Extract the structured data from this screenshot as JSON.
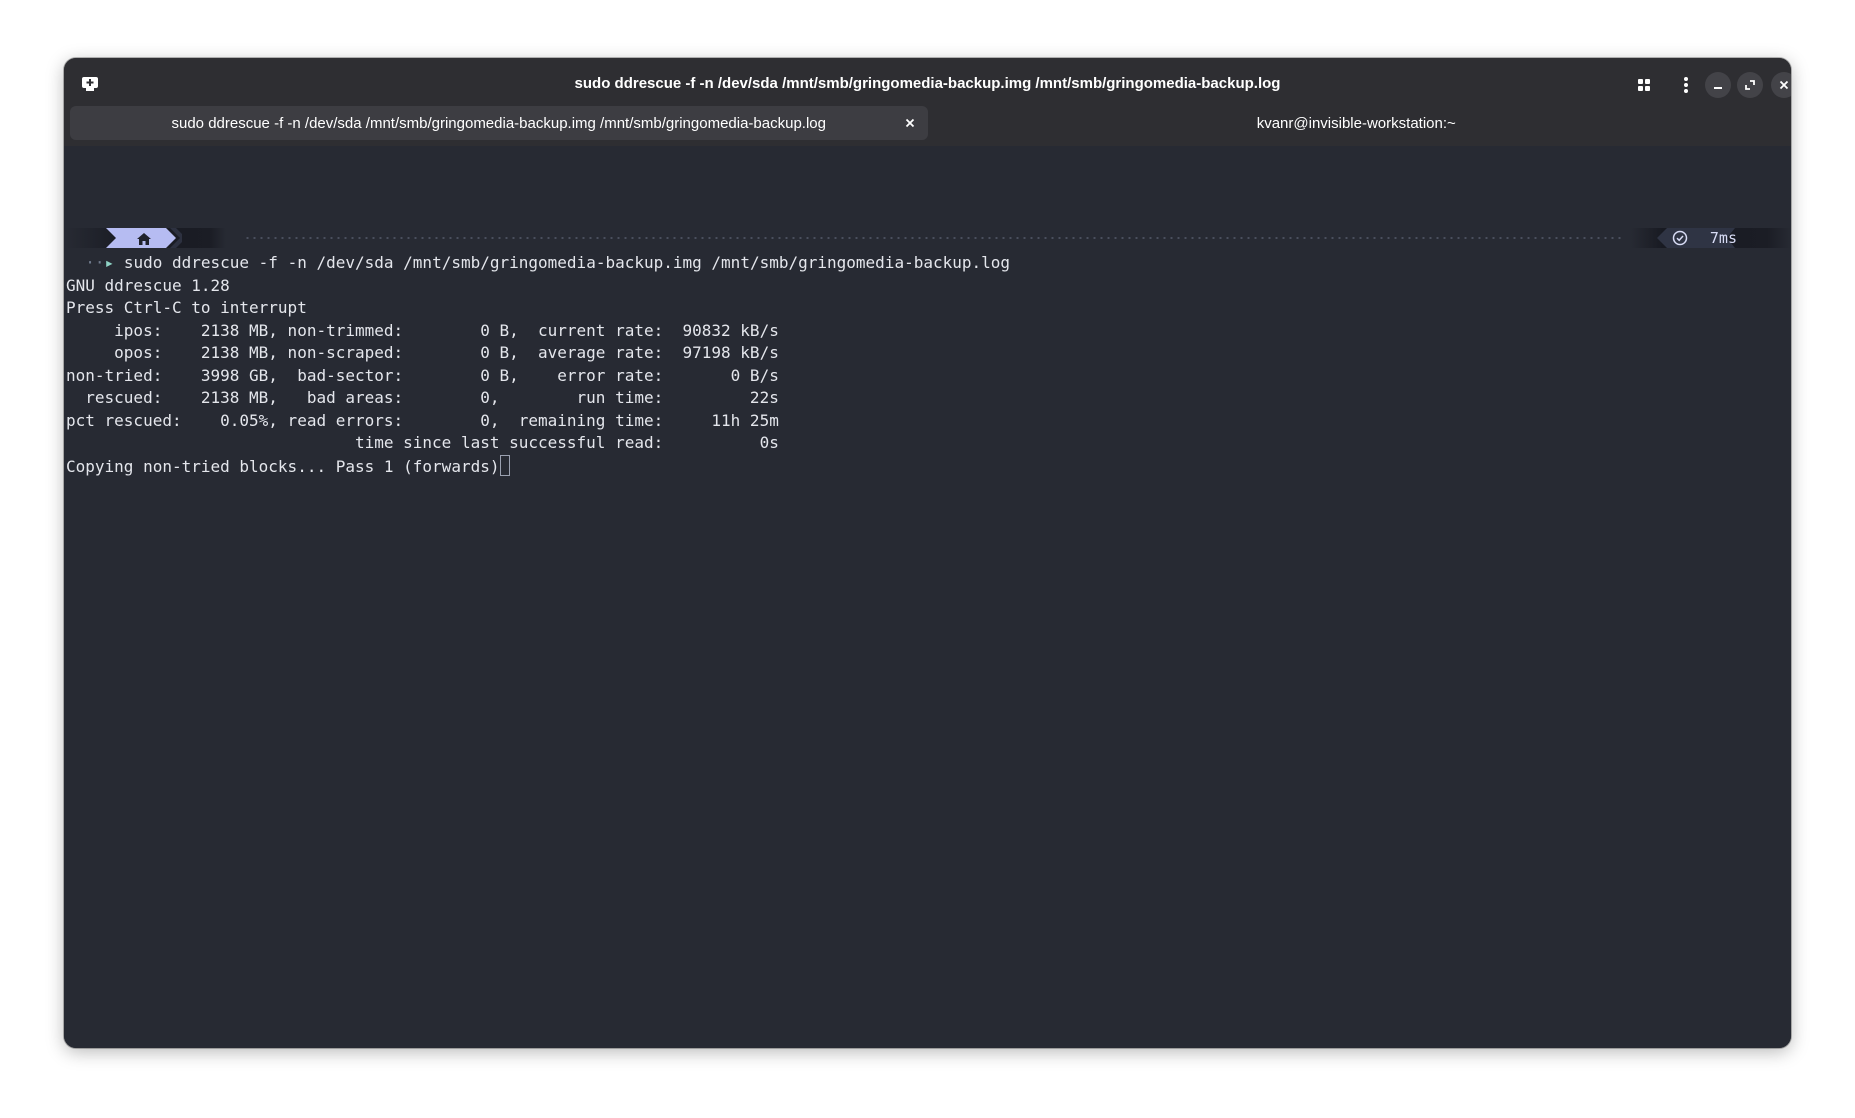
{
  "window": {
    "title": "sudo ddrescue -f -n /dev/sda /mnt/smb/gringomedia-backup.img /mnt/smb/gringomedia-backup.log",
    "icons": {
      "new_tab": "new-tab-icon",
      "grid": "grid-icon",
      "menu": "kebab-menu-icon",
      "minimize": "minimize-icon",
      "maximize": "maximize-icon",
      "close": "close-icon"
    }
  },
  "tabs": [
    {
      "label": "sudo ddrescue -f -n /dev/sda /mnt/smb/gringomedia-backup.img /mnt/smb/gringomedia-backup.log",
      "active": true
    },
    {
      "label": "kvanr@invisible-workstation:~",
      "active": false
    }
  ],
  "prompt": {
    "segment_icon": "home-icon",
    "duration": "7ms",
    "duration_icon": "check-circle-icon",
    "symbol": "·•▸",
    "accent_color": "#b6bcf2"
  },
  "terminal": {
    "command": "sudo ddrescue -f -n /dev/sda /mnt/smb/gringomedia-backup.img /mnt/smb/gringomedia-backup.log",
    "lines": [
      "GNU ddrescue 1.28",
      "Press Ctrl-C to interrupt",
      "     ipos:    2138 MB, non-trimmed:        0 B,  current rate:  90832 kB/s",
      "     opos:    2138 MB, non-scraped:        0 B,  average rate:  97198 kB/s",
      "non-tried:    3998 GB,  bad-sector:        0 B,    error rate:       0 B/s",
      "  rescued:    2138 MB,   bad areas:        0,        run time:         22s",
      "pct rescued:    0.05%, read errors:        0,  remaining time:     11h 25m",
      "                              time since last successful read:          0s"
    ],
    "status_line": "Copying non-tried blocks... Pass 1 (forwards)",
    "background_color": "#272a33",
    "text_color": "#e4e6ec"
  }
}
